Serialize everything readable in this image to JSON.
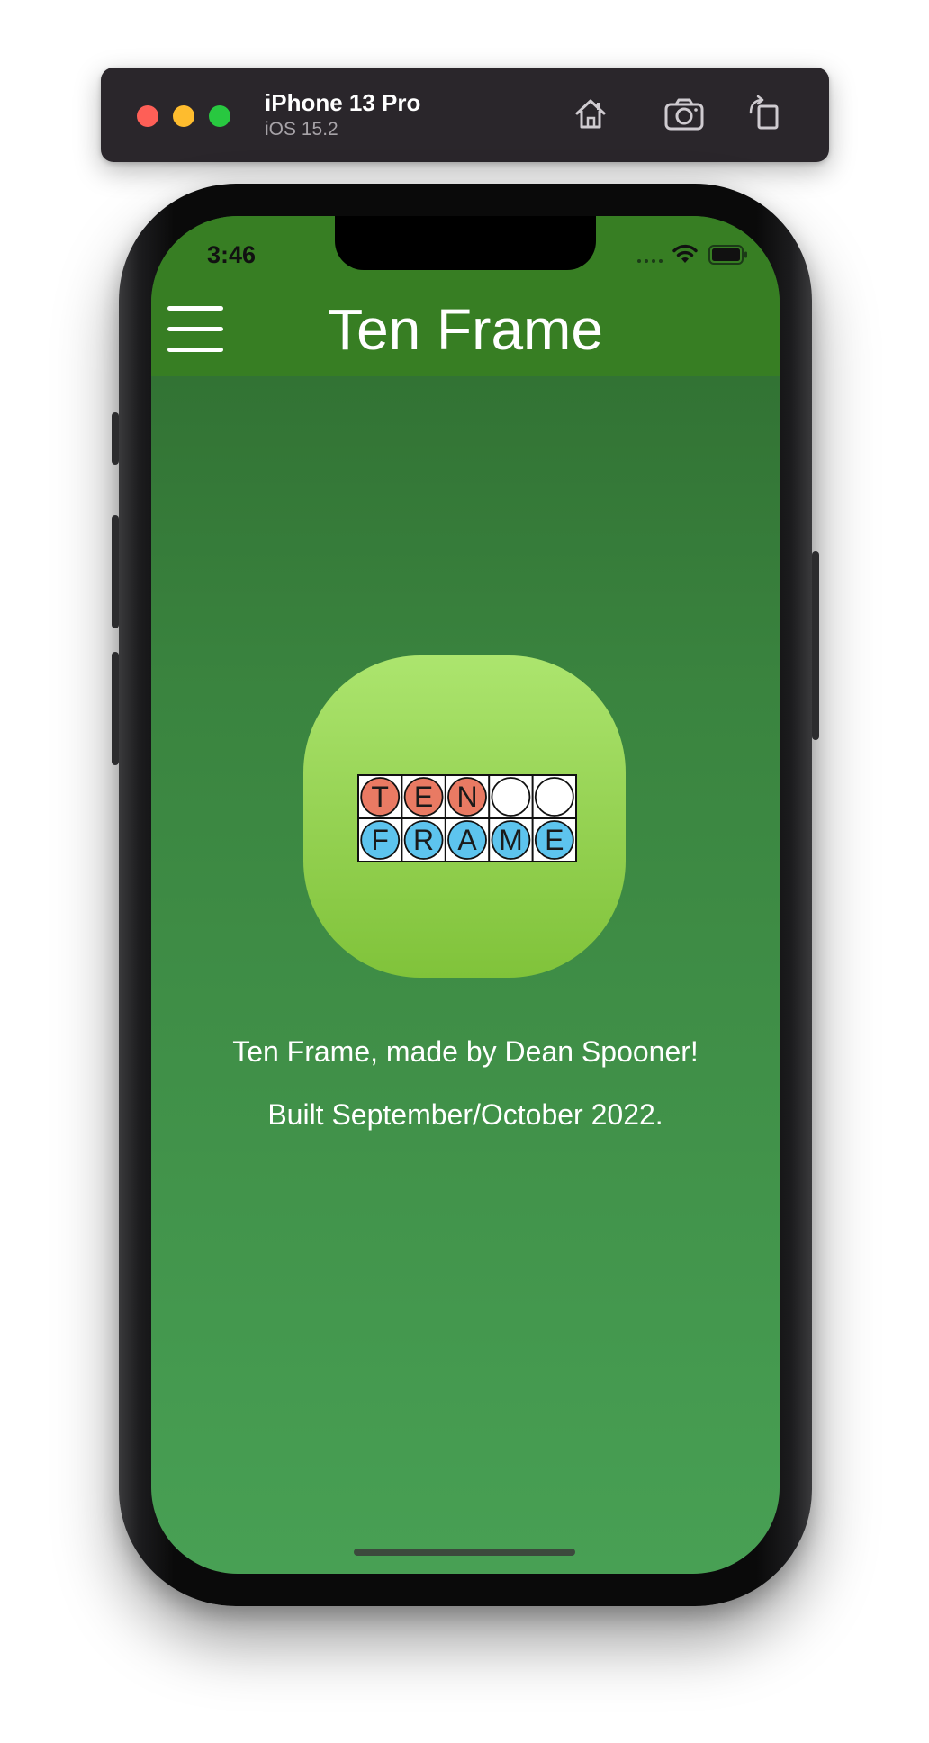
{
  "simulator": {
    "device_name": "iPhone 13 Pro",
    "os_version": "iOS 15.2",
    "buttons": [
      "home-icon",
      "screenshot-icon",
      "rotate-icon"
    ]
  },
  "status_bar": {
    "time": "3:46"
  },
  "app_bar": {
    "title": "Ten Frame",
    "menu_icon": "hamburger-menu-icon",
    "color": "#377e23"
  },
  "app_icon": {
    "row1": [
      "T",
      "E",
      "N",
      "",
      ""
    ],
    "row2": [
      "F",
      "R",
      "A",
      "M",
      "E"
    ],
    "row1_fill_colors": [
      "#e97a63",
      "#e97a63",
      "#e97a63",
      "#ffffff",
      "#ffffff"
    ],
    "row2_fill_colors": [
      "#5dc4ee",
      "#5dc4ee",
      "#5dc4ee",
      "#5dc4ee",
      "#5dc4ee"
    ]
  },
  "about": {
    "line1": "Ten Frame, made by Dean Spooner!",
    "line2": "Built September/October 2022."
  },
  "colors": {
    "background_top": "#2e6a2e",
    "background_bottom": "#48a054",
    "icon_top": "#ace56e",
    "icon_bottom": "#80c33a"
  }
}
